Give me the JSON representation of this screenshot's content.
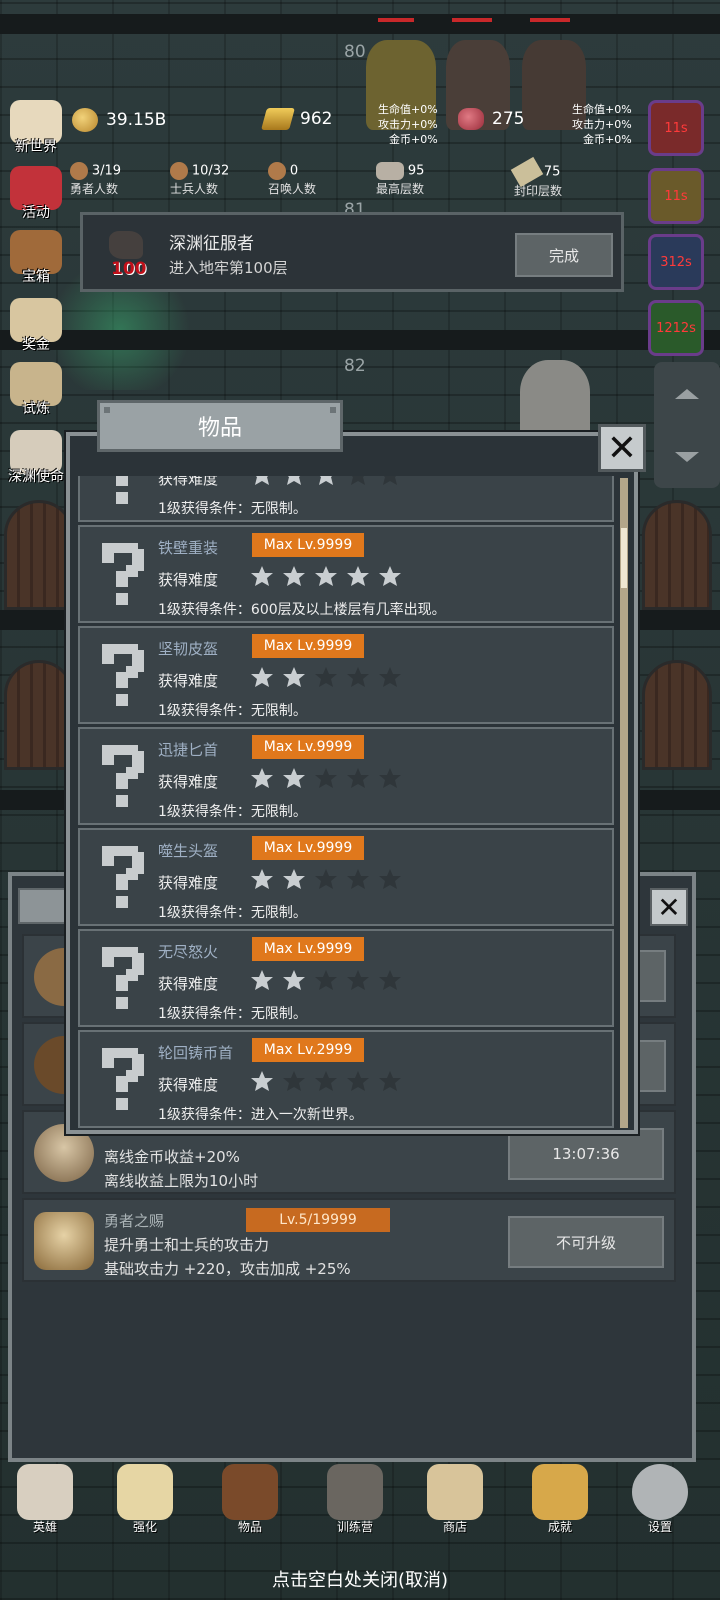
{
  "battle": {
    "floors": [
      "80",
      "81",
      "82"
    ]
  },
  "side_menu": [
    {
      "name": "side-new-world",
      "label": "新世界",
      "color": "#e7d9bd"
    },
    {
      "name": "side-activity",
      "label": "活动",
      "color": "#c2323a"
    },
    {
      "name": "side-treasure",
      "label": "宝箱",
      "color": "#a06a3a"
    },
    {
      "name": "side-reward",
      "label": "奖金",
      "color": "#d8c6a0"
    },
    {
      "name": "side-trial",
      "label": "试炼",
      "color": "#c8b48c"
    },
    {
      "name": "side-abyss",
      "label": "深渊使命",
      "color": "#d6ccbb"
    }
  ],
  "resources": {
    "coins": "39.15B",
    "gold_bars": "962",
    "meat": "275",
    "buff_left": [
      "生命值+0%",
      "攻击力+0%",
      "金币+0%"
    ],
    "buff_right": [
      "生命值+0%",
      "攻击力+0%",
      "金币+0%"
    ]
  },
  "stats": {
    "heroes_value": "3/19",
    "heroes_label": "勇者人数",
    "soldiers_value": "10/32",
    "soldiers_label": "士兵人数",
    "summon_value": "0",
    "summon_label": "召唤人数",
    "max_floor_value": "95",
    "max_floor_label": "最高层数",
    "seal_floor_value": "75",
    "seal_floor_label": "封印层数"
  },
  "timers": [
    "11s",
    "11s",
    "312s",
    "1212s"
  ],
  "achievement": {
    "badge_number": "100",
    "title": "深渊征服者",
    "desc": "进入地牢第100层",
    "button": "完成"
  },
  "upgrades": {
    "rows": [
      {
        "desc1": "离线金币收益+20%",
        "desc2": "离线收益上限为10小时",
        "action": "13:07:36"
      },
      {
        "name": "勇者之赐",
        "level": "Lv.5/19999",
        "desc1": "提升勇士和士兵的攻击力",
        "desc2": "基础攻击力 +220，攻击加成 +25%",
        "action": "不可升级"
      }
    ]
  },
  "modal": {
    "title": "物品",
    "difficulty_label": "获得难度",
    "items": [
      {
        "name": "",
        "max_level": "",
        "stars": 3,
        "condition": "1级获得条件：无限制。",
        "partial": true
      },
      {
        "name": "铁壁重装",
        "max_level": "Max Lv.9999",
        "stars": 5,
        "condition": "1级获得条件：600层及以上楼层有几率出现。"
      },
      {
        "name": "坚韧皮盔",
        "max_level": "Max Lv.9999",
        "stars": 2,
        "condition": "1级获得条件：无限制。"
      },
      {
        "name": "迅捷匕首",
        "max_level": "Max Lv.9999",
        "stars": 2,
        "condition": "1级获得条件：无限制。"
      },
      {
        "name": "噬生头盔",
        "max_level": "Max Lv.9999",
        "stars": 2,
        "condition": "1级获得条件：无限制。"
      },
      {
        "name": "无尽怒火",
        "max_level": "Max Lv.9999",
        "stars": 2,
        "condition": "1级获得条件：无限制。"
      },
      {
        "name": "轮回铸币首",
        "max_level": "Max Lv.2999",
        "stars": 1,
        "condition": "1级获得条件：进入一次新世界。"
      }
    ],
    "max_stars": 5
  },
  "bottom_nav": [
    {
      "name": "nav-hero",
      "label": "英雄",
      "color": "#d8cfc0"
    },
    {
      "name": "nav-enhance",
      "label": "强化",
      "color": "#e6d6a4"
    },
    {
      "name": "nav-items",
      "label": "物品",
      "color": "#7a4a2a"
    },
    {
      "name": "nav-training",
      "label": "训练营",
      "color": "#6a6660"
    },
    {
      "name": "nav-shop",
      "label": "商店",
      "color": "#d8c49a"
    },
    {
      "name": "nav-achievement",
      "label": "成就",
      "color": "#d7a84a"
    },
    {
      "name": "nav-settings",
      "label": "设置",
      "color": "#b0b4b6"
    }
  ],
  "close_hint": "点击空白处关闭(取消)",
  "colors": {
    "accent_orange": "#e0781c",
    "panel": "#3a4348",
    "star_filled": "#c9ced1",
    "star_empty": "#2f363a"
  }
}
